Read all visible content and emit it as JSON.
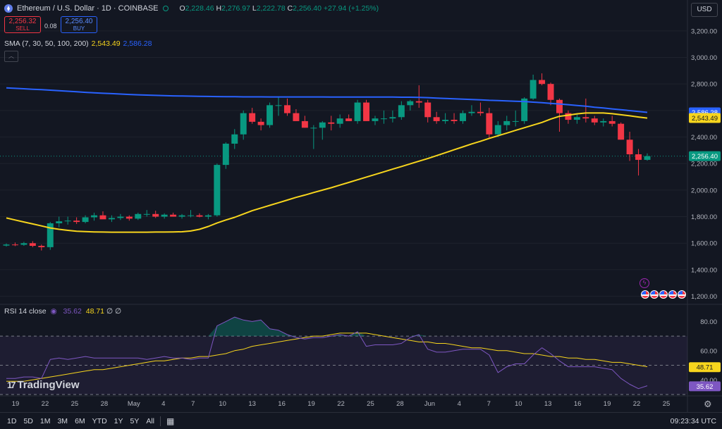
{
  "header": {
    "symbol": "Ethereum / U.S. Dollar · 1D · COINBASE",
    "open_label": "O",
    "open": "2,228.46",
    "high_label": "H",
    "high": "2,276.97",
    "low_label": "L",
    "low": "2,222.78",
    "close_label": "C",
    "close": "2,256.40",
    "change": "+27.94 (+1.25%)"
  },
  "trade": {
    "sell_price": "2,256.32",
    "sell_label": "SELL",
    "spread": "0.08",
    "buy_price": "2,256.40",
    "buy_label": "BUY"
  },
  "sma": {
    "label": "SMA (7, 30, 50, 100, 200)",
    "v1": "2,543.49",
    "v2": "2,586.28"
  },
  "rsi": {
    "label": "RSI 14 close",
    "v1": "35.62",
    "v2": "48.71",
    "v3": "∅",
    "v4": "∅"
  },
  "currency": "USD",
  "brand": "TradingView",
  "ranges": [
    "1D",
    "5D",
    "1M",
    "3M",
    "6M",
    "YTD",
    "1Y",
    "5Y",
    "All"
  ],
  "clock": "09:23:34 UTC",
  "colors": {
    "up": "#089981",
    "down": "#f23645",
    "sma_long": "#2962ff",
    "sma_mid": "#f7d51d",
    "rsi": "#7e57c2",
    "rsi_ma": "#f7d51d",
    "bg": "#131722"
  },
  "chart_data": [
    {
      "type": "candlestick",
      "title": "Ethereum / U.S. Dollar · 1D · COINBASE",
      "ylim": [
        1150,
        3300
      ],
      "yticks": [
        1200,
        1400,
        1600,
        1800,
        2000,
        2200,
        2400,
        2600,
        2800,
        3000,
        3200
      ],
      "ytick_labels": [
        "1,200.00",
        "1,400.00",
        "1,600.00",
        "1,800.00",
        "2,000.00",
        "2,200.00",
        "2,400.00",
        "2,600.00",
        "2,800.00",
        "3,000.00",
        "3,200.00"
      ],
      "xtick_labels": [
        "19",
        "22",
        "25",
        "28",
        "May",
        "4",
        "7",
        "10",
        "13",
        "16",
        "19",
        "22",
        "25",
        "28",
        "Jun",
        "4",
        "7",
        "10",
        "13",
        "16",
        "19",
        "22",
        "25"
      ],
      "price_tags": [
        {
          "value": 2586.28,
          "label": "2,586.28",
          "color": "#2962ff"
        },
        {
          "value": 2543.49,
          "label": "2,543.49",
          "color": "#f7d51d"
        },
        {
          "value": 2256.4,
          "label": "2,256.40",
          "color": "#089981"
        }
      ],
      "candles": [
        [
          1582,
          1598,
          1575,
          1590
        ],
        [
          1590,
          1605,
          1578,
          1585
        ],
        [
          1588,
          1610,
          1580,
          1600
        ],
        [
          1600,
          1615,
          1570,
          1580
        ],
        [
          1580,
          1590,
          1545,
          1570
        ],
        [
          1570,
          1760,
          1550,
          1750
        ],
        [
          1750,
          1800,
          1720,
          1765
        ],
        [
          1765,
          1800,
          1740,
          1770
        ],
        [
          1770,
          1795,
          1745,
          1760
        ],
        [
          1760,
          1810,
          1750,
          1795
        ],
        [
          1795,
          1830,
          1770,
          1810
        ],
        [
          1810,
          1840,
          1795,
          1780
        ],
        [
          1780,
          1810,
          1760,
          1790
        ],
        [
          1790,
          1820,
          1775,
          1800
        ],
        [
          1800,
          1810,
          1770,
          1785
        ],
        [
          1785,
          1830,
          1775,
          1820
        ],
        [
          1820,
          1850,
          1800,
          1820
        ],
        [
          1820,
          1845,
          1790,
          1800
        ],
        [
          1800,
          1825,
          1785,
          1815
        ],
        [
          1815,
          1830,
          1800,
          1800
        ],
        [
          1800,
          1820,
          1785,
          1810
        ],
        [
          1810,
          1850,
          1795,
          1810
        ],
        [
          1810,
          1825,
          1795,
          1800
        ],
        [
          1800,
          1820,
          1780,
          1810
        ],
        [
          1810,
          2200,
          1800,
          2190
        ],
        [
          2190,
          2360,
          2160,
          2350
        ],
        [
          2350,
          2460,
          2310,
          2420
        ],
        [
          2420,
          2600,
          2380,
          2580
        ],
        [
          2580,
          2620,
          2500,
          2515
        ],
        [
          2515,
          2540,
          2450,
          2490
        ],
        [
          2490,
          2660,
          2470,
          2640
        ],
        [
          2640,
          2700,
          2560,
          2640
        ],
        [
          2640,
          2690,
          2560,
          2580
        ],
        [
          2580,
          2610,
          2520,
          2520
        ],
        [
          2520,
          2560,
          2470,
          2470
        ],
        [
          2470,
          2490,
          2310,
          2470
        ],
        [
          2470,
          2520,
          2380,
          2510
        ],
        [
          2510,
          2560,
          2450,
          2500
        ],
        [
          2500,
          2570,
          2470,
          2540
        ],
        [
          2540,
          2570,
          2520,
          2520
        ],
        [
          2520,
          2680,
          2500,
          2660
        ],
        [
          2660,
          2680,
          2520,
          2520
        ],
        [
          2520,
          2560,
          2490,
          2540
        ],
        [
          2540,
          2600,
          2500,
          2540
        ],
        [
          2540,
          2600,
          2510,
          2550
        ],
        [
          2550,
          2670,
          2530,
          2640
        ],
        [
          2640,
          2680,
          2600,
          2670
        ],
        [
          2670,
          2790,
          2620,
          2660
        ],
        [
          2660,
          2680,
          2510,
          2550
        ],
        [
          2550,
          2590,
          2500,
          2520
        ],
        [
          2520,
          2580,
          2500,
          2530
        ],
        [
          2530,
          2580,
          2500,
          2520
        ],
        [
          2520,
          2600,
          2500,
          2580
        ],
        [
          2580,
          2640,
          2560,
          2590
        ],
        [
          2590,
          2660,
          2560,
          2580
        ],
        [
          2580,
          2620,
          2390,
          2420
        ],
        [
          2420,
          2520,
          2400,
          2490
        ],
        [
          2490,
          2560,
          2450,
          2520
        ],
        [
          2520,
          2600,
          2480,
          2520
        ],
        [
          2520,
          2700,
          2500,
          2690
        ],
        [
          2690,
          2870,
          2680,
          2830
        ],
        [
          2830,
          2880,
          2790,
          2800
        ],
        [
          2800,
          2810,
          2640,
          2680
        ],
        [
          2680,
          2690,
          2440,
          2580
        ],
        [
          2580,
          2600,
          2500,
          2530
        ],
        [
          2530,
          2570,
          2500,
          2550
        ],
        [
          2550,
          2690,
          2510,
          2540
        ],
        [
          2540,
          2560,
          2490,
          2510
        ],
        [
          2510,
          2540,
          2480,
          2520
        ],
        [
          2520,
          2560,
          2480,
          2500
        ],
        [
          2500,
          2510,
          2380,
          2380
        ],
        [
          2380,
          2440,
          2220,
          2270
        ],
        [
          2270,
          2310,
          2110,
          2228
        ],
        [
          2228,
          2277,
          2222,
          2256
        ]
      ],
      "series": [
        {
          "name": "SMA",
          "color": "#2962ff",
          "values": [
            2770,
            2767,
            2764,
            2760,
            2757,
            2753,
            2749,
            2745,
            2741,
            2737,
            2733,
            2730,
            2727,
            2724,
            2721,
            2718,
            2716,
            2714,
            2712,
            2710,
            2709,
            2708,
            2707,
            2706,
            2705,
            2704,
            2704,
            2703,
            2703,
            2703,
            2702,
            2702,
            2702,
            2702,
            2702,
            2702,
            2702,
            2701,
            2701,
            2701,
            2701,
            2701,
            2701,
            2701,
            2701,
            2700,
            2700,
            2699,
            2697,
            2694,
            2691,
            2688,
            2685,
            2683,
            2680,
            2677,
            2675,
            2672,
            2670,
            2668,
            2663,
            2659,
            2654,
            2649,
            2644,
            2638,
            2632,
            2625,
            2619,
            2612,
            2606,
            2599,
            2593,
            2586
          ]
        },
        {
          "name": "SMA",
          "color": "#f7d51d",
          "values": [
            1790,
            1775,
            1760,
            1745,
            1730,
            1715,
            1705,
            1697,
            1690,
            1687,
            1685,
            1684,
            1683,
            1683,
            1683,
            1683,
            1683,
            1684,
            1684,
            1685,
            1686,
            1692,
            1705,
            1726,
            1752,
            1775,
            1795,
            1820,
            1845,
            1865,
            1885,
            1905,
            1925,
            1945,
            1963,
            1982,
            2000,
            2018,
            2038,
            2058,
            2078,
            2098,
            2118,
            2138,
            2158,
            2178,
            2198,
            2218,
            2238,
            2260,
            2282,
            2304,
            2326,
            2348,
            2368,
            2390,
            2410,
            2430,
            2450,
            2470,
            2490,
            2510,
            2535,
            2556,
            2565,
            2575,
            2581,
            2581,
            2581,
            2576,
            2568,
            2560,
            2551,
            2543
          ]
        }
      ]
    },
    {
      "type": "line",
      "title": "RSI 14 close",
      "ylim": [
        30,
        85
      ],
      "yticks": [
        40,
        60,
        80
      ],
      "ytick_labels": [
        "40.00",
        "60.00",
        "80.00"
      ],
      "bands": [
        70,
        50,
        30
      ],
      "price_tags": [
        {
          "value": 48.71,
          "label": "48.71",
          "color": "#f7d51d"
        },
        {
          "value": 35.62,
          "label": "35.62",
          "color": "#7e57c2"
        }
      ],
      "series": [
        {
          "name": "RSI",
          "color": "#7e57c2",
          "values": [
            41,
            41,
            42,
            42,
            41,
            54,
            55,
            54,
            55,
            56,
            55,
            55,
            55,
            55,
            55,
            55,
            54,
            55,
            56,
            55,
            55,
            54,
            55,
            55,
            77,
            80,
            83,
            81,
            80,
            81,
            75,
            74,
            71,
            69,
            68,
            69,
            69,
            70,
            71,
            70,
            73,
            63,
            64,
            64,
            64,
            65,
            69,
            71,
            61,
            59,
            59,
            60,
            61,
            61,
            61,
            57,
            45,
            49,
            51,
            51,
            57,
            62,
            58,
            53,
            49,
            49,
            49,
            49,
            48,
            47,
            41,
            37,
            34,
            36
          ]
        },
        {
          "name": "RSI-based MA",
          "color": "#f7d51d",
          "values": [
            39,
            39,
            39,
            40,
            41,
            42,
            43,
            44,
            45,
            46,
            47,
            47,
            48,
            49,
            50,
            51,
            52,
            53,
            53,
            54,
            55,
            55,
            56,
            56,
            57,
            58,
            60,
            61,
            63,
            64,
            65,
            66,
            67,
            68,
            69,
            70,
            70,
            71,
            72,
            72,
            72,
            72,
            71,
            70,
            69,
            68,
            67,
            66,
            66,
            65,
            65,
            64,
            63,
            62,
            62,
            61,
            60,
            60,
            59,
            58,
            58,
            57,
            56,
            56,
            55,
            55,
            54,
            54,
            53,
            52,
            52,
            51,
            50,
            49
          ]
        }
      ]
    }
  ]
}
